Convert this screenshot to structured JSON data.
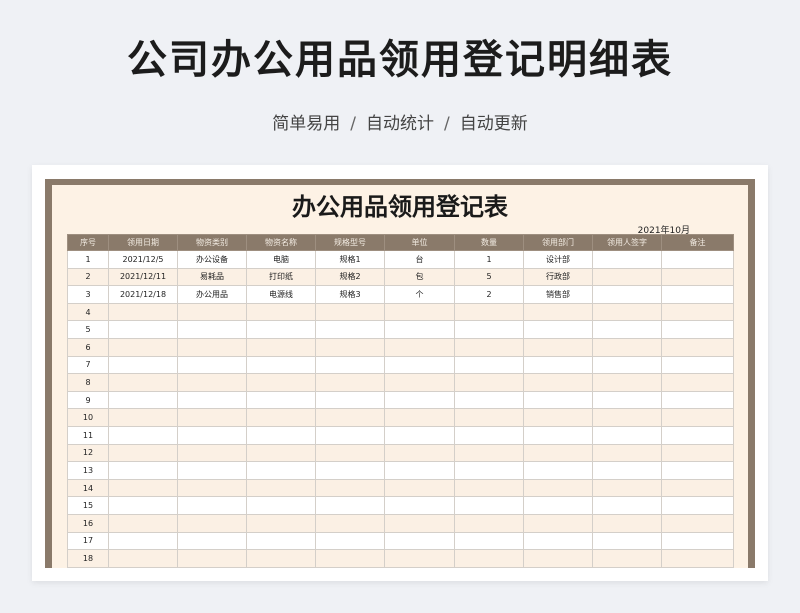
{
  "header": {
    "title": "公司办公用品领用登记明细表",
    "features": [
      "简单易用",
      "自动统计",
      "自动更新"
    ],
    "separator": "/"
  },
  "sheet": {
    "title": "办公用品领用登记表",
    "date": "2021年10月",
    "columns": [
      "序号",
      "领用日期",
      "物资类别",
      "物资名称",
      "规格型号",
      "单位",
      "数量",
      "领用部门",
      "领用人签字",
      "备注"
    ],
    "rows": [
      [
        "1",
        "2021/12/5",
        "办公设备",
        "电脑",
        "规格1",
        "台",
        "1",
        "设计部",
        "",
        ""
      ],
      [
        "2",
        "2021/12/11",
        "易耗品",
        "打印纸",
        "规格2",
        "包",
        "5",
        "行政部",
        "",
        ""
      ],
      [
        "3",
        "2021/12/18",
        "办公用品",
        "电源线",
        "规格3",
        "个",
        "2",
        "销售部",
        "",
        ""
      ],
      [
        "4",
        "",
        "",
        "",
        "",
        "",
        "",
        "",
        "",
        ""
      ],
      [
        "5",
        "",
        "",
        "",
        "",
        "",
        "",
        "",
        "",
        ""
      ],
      [
        "6",
        "",
        "",
        "",
        "",
        "",
        "",
        "",
        "",
        ""
      ],
      [
        "7",
        "",
        "",
        "",
        "",
        "",
        "",
        "",
        "",
        ""
      ],
      [
        "8",
        "",
        "",
        "",
        "",
        "",
        "",
        "",
        "",
        ""
      ],
      [
        "9",
        "",
        "",
        "",
        "",
        "",
        "",
        "",
        "",
        ""
      ],
      [
        "10",
        "",
        "",
        "",
        "",
        "",
        "",
        "",
        "",
        ""
      ],
      [
        "11",
        "",
        "",
        "",
        "",
        "",
        "",
        "",
        "",
        ""
      ],
      [
        "12",
        "",
        "",
        "",
        "",
        "",
        "",
        "",
        "",
        ""
      ],
      [
        "13",
        "",
        "",
        "",
        "",
        "",
        "",
        "",
        "",
        ""
      ],
      [
        "14",
        "",
        "",
        "",
        "",
        "",
        "",
        "",
        "",
        ""
      ],
      [
        "15",
        "",
        "",
        "",
        "",
        "",
        "",
        "",
        "",
        ""
      ],
      [
        "16",
        "",
        "",
        "",
        "",
        "",
        "",
        "",
        "",
        ""
      ],
      [
        "17",
        "",
        "",
        "",
        "",
        "",
        "",
        "",
        "",
        ""
      ],
      [
        "18",
        "",
        "",
        "",
        "",
        "",
        "",
        "",
        "",
        ""
      ]
    ]
  },
  "colors": {
    "frame": "#8a7a6a",
    "sheet_bg": "#fdf2e5",
    "page_bg": "#eff1f5"
  }
}
